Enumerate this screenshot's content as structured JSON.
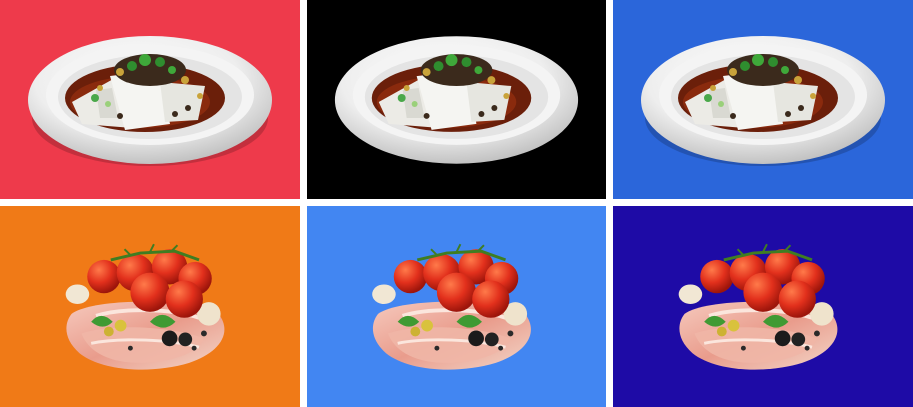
{
  "tiles": [
    {
      "id": "dish-red",
      "subject": "noodle-dish-icon",
      "background": "#EE3A4B"
    },
    {
      "id": "dish-black",
      "subject": "noodle-dish-icon",
      "background": "#000000"
    },
    {
      "id": "dish-blue",
      "subject": "noodle-dish-icon",
      "background": "#2B66DA"
    },
    {
      "id": "veg-orange",
      "subject": "tomato-ham-still-life-icon",
      "background": "#F07A17"
    },
    {
      "id": "veg-lightblue",
      "subject": "tomato-ham-still-life-icon",
      "background": "#4286F2"
    },
    {
      "id": "veg-darkblue",
      "subject": "tomato-ham-still-life-icon",
      "background": "#1E0BA6"
    }
  ]
}
